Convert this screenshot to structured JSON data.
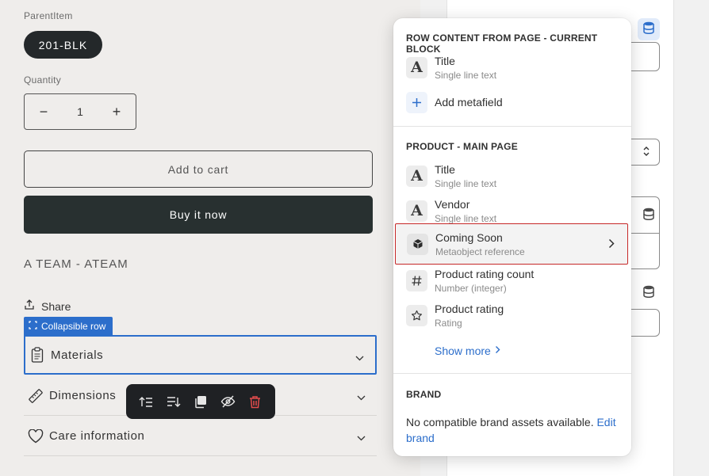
{
  "preview": {
    "parent_item_label": "ParentItem",
    "variant_value": "201-BLK",
    "quantity_label": "Quantity",
    "quantity_value": "1",
    "minus": "−",
    "plus": "+",
    "add_to_cart": "Add to cart",
    "buy_now": "Buy it now",
    "vendor": "A TEAM - ATEAM",
    "share": "Share",
    "collapsible_tag": "Collapsible row",
    "rows": [
      {
        "label": "Materials",
        "icon": "clipboard-icon"
      },
      {
        "label": "Dimensions",
        "icon": "ruler-icon"
      },
      {
        "label": "Care information",
        "icon": "heart-icon"
      }
    ]
  },
  "toolbar": {
    "icons": [
      "move-up-icon",
      "move-down-icon",
      "duplicate-icon",
      "hide-icon",
      "delete-icon"
    ]
  },
  "popover": {
    "section1_title": "ROW CONTENT FROM PAGE - CURRENT BLOCK",
    "section1_items": [
      {
        "title": "Title",
        "subtitle": "Single line text",
        "icon": "text-a-icon"
      }
    ],
    "add_metafield": "Add metafield",
    "section2_title": "PRODUCT - MAIN PAGE",
    "section2_items": [
      {
        "title": "Title",
        "subtitle": "Single line text",
        "icon": "text-a-icon"
      },
      {
        "title": "Vendor",
        "subtitle": "Single line text",
        "icon": "text-a-icon"
      },
      {
        "title": "Coming Soon",
        "subtitle": "Metaobject reference",
        "icon": "metaobject-icon"
      },
      {
        "title": "Product rating count",
        "subtitle": "Number (integer)",
        "icon": "hash-icon"
      },
      {
        "title": "Product rating",
        "subtitle": "Rating",
        "icon": "star-icon"
      }
    ],
    "show_more": "Show more",
    "section3_title": "BRAND",
    "brand_text": "No compatible brand assets available.",
    "brand_link_1": "Edit",
    "brand_link_2": "brand"
  },
  "colors": {
    "accent": "#2c6ecb",
    "highlight_border": "#c62828",
    "dark_button": "#283030"
  }
}
